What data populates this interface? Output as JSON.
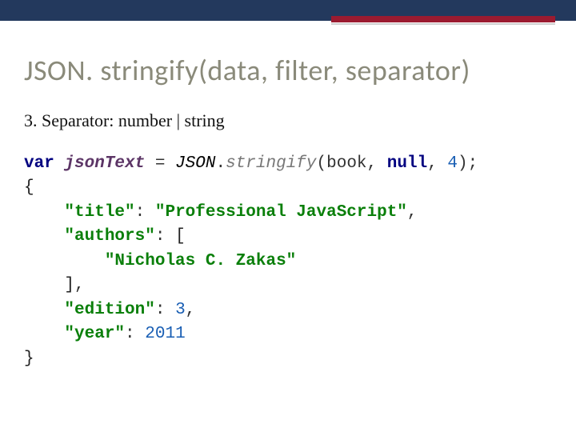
{
  "header": {
    "title": "JSON. stringify(data, filter, separator)"
  },
  "subhead": "3. Separator: number | string",
  "code": {
    "l1": {
      "kw": "var",
      "decl": "jsonText",
      "eq": " = ",
      "obj": "JSON",
      "dot": ".",
      "meth": "stringify",
      "open": "(",
      "arg1": "book",
      "c1": ", ",
      "arg2": "null",
      "c2": ", ",
      "arg3": "4",
      "close": ");"
    },
    "l2": "{",
    "l3": {
      "indent": "    ",
      "key": "\"title\"",
      "colon": ": ",
      "val": "\"Professional JavaScript\"",
      "comma": ","
    },
    "l4": {
      "indent": "    ",
      "key": "\"authors\"",
      "colon": ": ",
      "open": "["
    },
    "l5": {
      "indent": "        ",
      "val": "\"Nicholas C. Zakas\""
    },
    "l6": {
      "indent": "    ",
      "close": "]",
      "comma": ","
    },
    "l7": {
      "indent": "    ",
      "key": "\"edition\"",
      "colon": ": ",
      "val": "3",
      "comma": ","
    },
    "l8": {
      "indent": "    ",
      "key": "\"year\"",
      "colon": ": ",
      "val": "2011"
    },
    "l9": "}"
  }
}
